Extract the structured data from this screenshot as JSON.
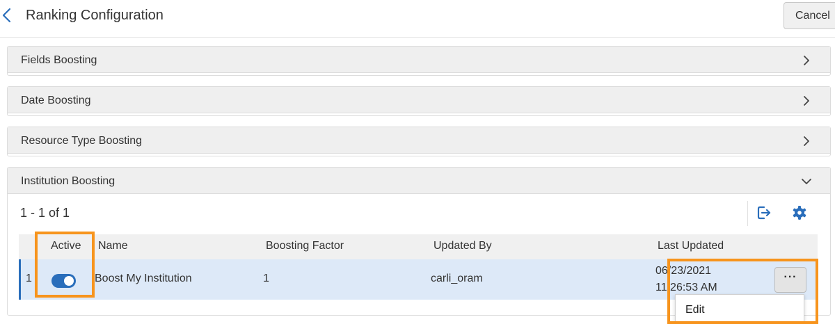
{
  "header": {
    "title": "Ranking Configuration",
    "cancel_label": "Cancel"
  },
  "panels": [
    {
      "title": "Fields Boosting",
      "expanded": false
    },
    {
      "title": "Date Boosting",
      "expanded": false
    },
    {
      "title": "Resource Type Boosting",
      "expanded": false
    },
    {
      "title": "Institution Boosting",
      "expanded": true
    }
  ],
  "institution": {
    "count_text": "1 - 1 of 1",
    "columns": [
      "Active",
      "Name",
      "Boosting Factor",
      "Updated By",
      "Last Updated"
    ],
    "rows": [
      {
        "index": "1",
        "active": true,
        "name": "Boost My Institution",
        "factor": "1",
        "updated_by": "carli_oram",
        "date": "06/23/2021",
        "time": "11:26:53 AM"
      }
    ],
    "row_menu": {
      "button_label": "···",
      "items": [
        "Edit"
      ]
    }
  },
  "icons": {
    "back": "chevron-left-icon",
    "expand": "chevron-right-icon",
    "collapse": "chevron-down-icon",
    "export": "export-icon",
    "settings": "gear-icon",
    "more": "more-icon"
  },
  "colors": {
    "accent": "#2a6ebb",
    "highlight": "#f7941d",
    "row_selected": "#dde9f8"
  }
}
